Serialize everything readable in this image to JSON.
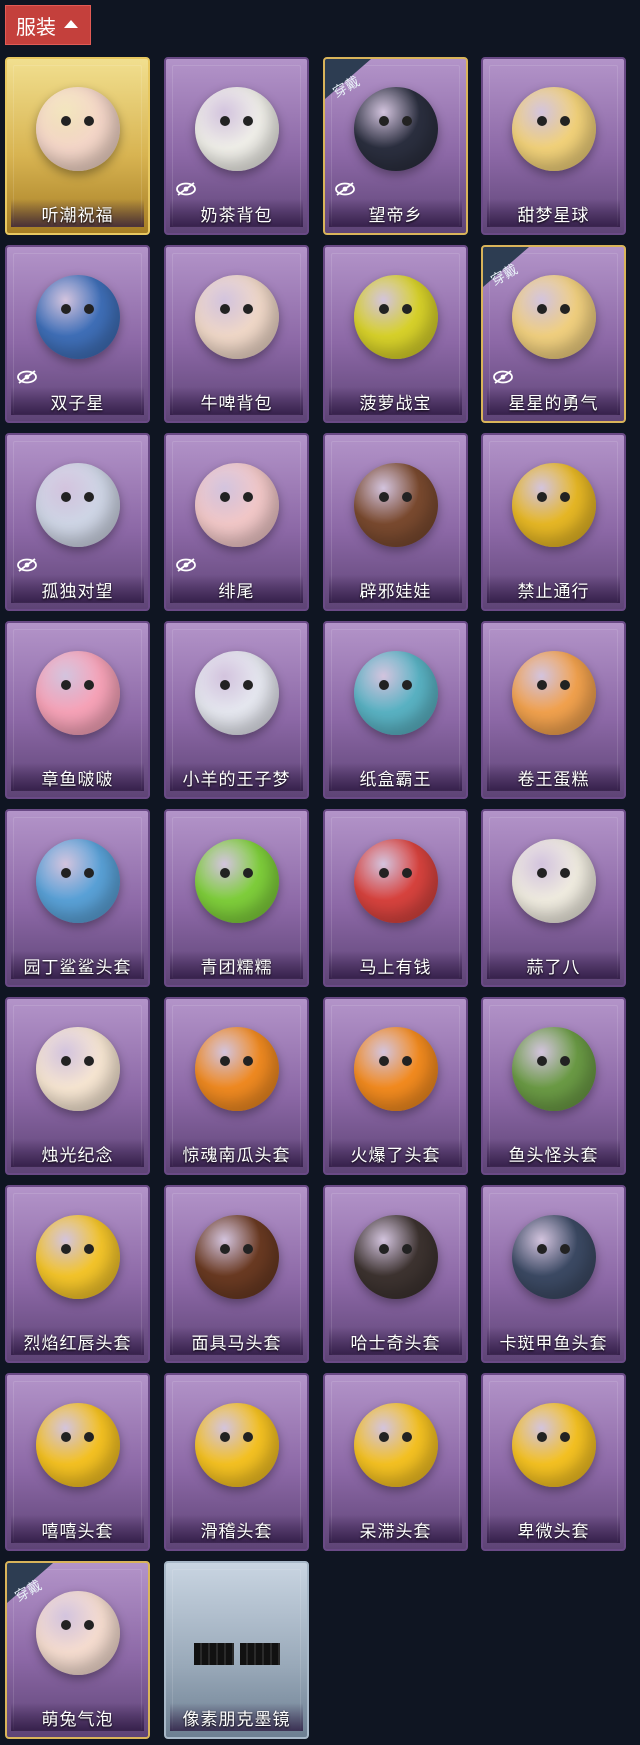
{
  "header": {
    "tab_label": "服装"
  },
  "badge_text": "穿戴",
  "items": [
    {
      "name": "听潮祝福",
      "style": "gold",
      "art": "#f4d6c8",
      "hidden": false,
      "worn": false
    },
    {
      "name": "奶茶背包",
      "style": "purple",
      "art": "#f0efe9",
      "hidden": true,
      "worn": false
    },
    {
      "name": "望帝乡",
      "style": "purple",
      "art": "#2b2f3f",
      "hidden": true,
      "worn": true
    },
    {
      "name": "甜梦星球",
      "style": "purple",
      "art": "#f2d27a",
      "hidden": false,
      "worn": false
    },
    {
      "name": "双子星",
      "style": "purple",
      "art": "#3f6fb8",
      "hidden": true,
      "worn": false
    },
    {
      "name": "牛啤背包",
      "style": "purple",
      "art": "#f0d8c8",
      "hidden": false,
      "worn": false
    },
    {
      "name": "菠萝战宝",
      "style": "purple",
      "art": "#d8d22a",
      "hidden": false,
      "worn": false
    },
    {
      "name": "星星的勇气",
      "style": "purple",
      "art": "#f1d07f",
      "hidden": true,
      "worn": true
    },
    {
      "name": "孤独对望",
      "style": "purple",
      "art": "#cfd6e6",
      "hidden": true,
      "worn": false
    },
    {
      "name": "绯尾",
      "style": "purple",
      "art": "#f2c8c8",
      "hidden": true,
      "worn": false
    },
    {
      "name": "辟邪娃娃",
      "style": "purple",
      "art": "#7a4a2f",
      "hidden": false,
      "worn": false
    },
    {
      "name": "禁止通行",
      "style": "purple",
      "art": "#e7b825",
      "hidden": false,
      "worn": false
    },
    {
      "name": "章鱼啵啵",
      "style": "purple",
      "art": "#f7a3b8",
      "hidden": false,
      "worn": false
    },
    {
      "name": "小羊的王子梦",
      "style": "purple",
      "art": "#e6e8f0",
      "hidden": false,
      "worn": false
    },
    {
      "name": "纸盒霸王",
      "style": "purple",
      "art": "#5ab3c4",
      "hidden": false,
      "worn": false
    },
    {
      "name": "卷王蛋糕",
      "style": "purple",
      "art": "#f2a24e",
      "hidden": false,
      "worn": false
    },
    {
      "name": "园丁鲨鲨头套",
      "style": "purple",
      "art": "#5aa2d8",
      "hidden": false,
      "worn": false
    },
    {
      "name": "青团糯糯",
      "style": "purple",
      "art": "#7fcf3b",
      "hidden": false,
      "worn": false
    },
    {
      "name": "马上有钱",
      "style": "purple",
      "art": "#d8433e",
      "hidden": false,
      "worn": false
    },
    {
      "name": "蒜了八",
      "style": "purple",
      "art": "#f0ece0",
      "hidden": false,
      "worn": false
    },
    {
      "name": "烛光纪念",
      "style": "purple",
      "art": "#f7e6d2",
      "hidden": false,
      "worn": false
    },
    {
      "name": "惊魂南瓜头套",
      "style": "purple",
      "art": "#f08a21",
      "hidden": false,
      "worn": false
    },
    {
      "name": "火爆了头套",
      "style": "purple",
      "art": "#f38b1f",
      "hidden": false,
      "worn": false
    },
    {
      "name": "鱼头怪头套",
      "style": "purple",
      "art": "#6b9b45",
      "hidden": false,
      "worn": false
    },
    {
      "name": "烈焰红唇头套",
      "style": "purple",
      "art": "#f4c52a",
      "hidden": false,
      "worn": false
    },
    {
      "name": "面具马头套",
      "style": "purple",
      "art": "#6a3a22",
      "hidden": false,
      "worn": false
    },
    {
      "name": "哈士奇头套",
      "style": "purple",
      "art": "#3d3330",
      "hidden": false,
      "worn": false
    },
    {
      "name": "卡斑甲鱼头套",
      "style": "purple",
      "art": "#3c4a64",
      "hidden": false,
      "worn": false
    },
    {
      "name": "嘻嘻头套",
      "style": "purple",
      "art": "#f5c222",
      "hidden": false,
      "worn": false
    },
    {
      "name": "滑稽头套",
      "style": "purple",
      "art": "#f5c222",
      "hidden": false,
      "worn": false
    },
    {
      "name": "呆滞头套",
      "style": "purple",
      "art": "#f5c222",
      "hidden": false,
      "worn": false
    },
    {
      "name": "卑微头套",
      "style": "purple",
      "art": "#f5c222",
      "hidden": false,
      "worn": false
    },
    {
      "name": "萌兔气泡",
      "style": "purple",
      "art": "#f6ddd0",
      "hidden": false,
      "worn": true
    },
    {
      "name": "像素朋克墨镜",
      "style": "silver",
      "art": "#111111",
      "hidden": false,
      "worn": false
    }
  ]
}
